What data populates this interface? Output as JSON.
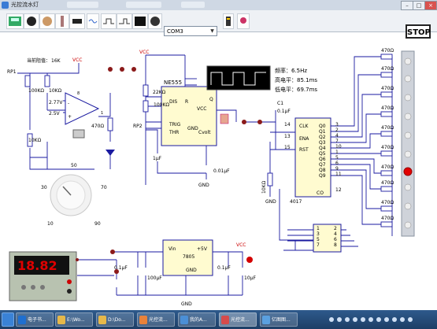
{
  "window": {
    "title": "光控流水灯"
  },
  "toolbar": {
    "port": "COM3",
    "stop_label": "STOP"
  },
  "circuit": {
    "threshold_label": "当前阻值：",
    "threshold_value": "16K",
    "vcc": "VCC",
    "gnd": "GND",
    "rp1": "RP1",
    "rp2": "RP2",
    "r_100k_a": "100KΩ",
    "r_10k_a": "10KΩ",
    "v_277": "2.77V",
    "v_25": "2.5V",
    "r_10k_b": "10KΩ",
    "r_470_a": "470Ω",
    "r_22k": "22KΩ",
    "r_100k_b": "100KΩ",
    "cap_1uf": "1μF",
    "cap_001uf": "0.01μF",
    "ic555": "NE555",
    "pin_dis": "DIS",
    "pin_r": "R",
    "pin_vcc": "VCC",
    "pin_trig": "TRIG",
    "pin_thr": "THR",
    "pin_gnd": "GND",
    "pin_cvolt": "Cvolt",
    "pin_q": "Q",
    "c1": "C1",
    "c1_val": "0.1μF",
    "freq_text": "频率：6.5Hz",
    "high_text": "高电平：85.1ms",
    "low_text": "低电平：69.7ms",
    "ic4017": "4017",
    "clk": "CLK",
    "ena": "ENA",
    "rst": "RST",
    "co": "CO",
    "q_labels": [
      "Q0",
      "Q1",
      "Q2",
      "Q3",
      "Q4",
      "Q5",
      "Q6",
      "Q7",
      "Q8",
      "Q9"
    ],
    "q_pins": [
      "3",
      "2",
      "4",
      "7",
      "10",
      "1",
      "5",
      "6",
      "9",
      "11"
    ],
    "pin_14": "14",
    "pin_13": "13",
    "pin_15": "15",
    "pin_12": "12",
    "r_10k_c": "10KΩ",
    "led_resistor": "470Ω",
    "dial_ticks": [
      "10",
      "30",
      "50",
      "70",
      "90"
    ],
    "reg_chip": "7805",
    "reg_vin": "Vin",
    "reg_plus5": "+5V",
    "reg_gnd": "GND",
    "cap_01_a": "0.1μF",
    "cap_100u": "100μF",
    "cap_01_b": "0.1μF",
    "cap_10u": "10μF",
    "diode_pins_left": [
      "1",
      "3",
      "5",
      "7"
    ],
    "diode_pins_right": [
      "2",
      "4",
      "6",
      "8"
    ],
    "supply_display": "18.82"
  },
  "taskbar": {
    "items": [
      "电子书...",
      "E:\\Wo...",
      "D:\\Do...",
      "光控流...",
      "我的A...",
      "光控流...",
      "亿图图..."
    ]
  },
  "colors": {
    "wire": "#1a1aa0",
    "node": "#8b1a1a",
    "red": "#d40000",
    "led_bg": "#111"
  }
}
